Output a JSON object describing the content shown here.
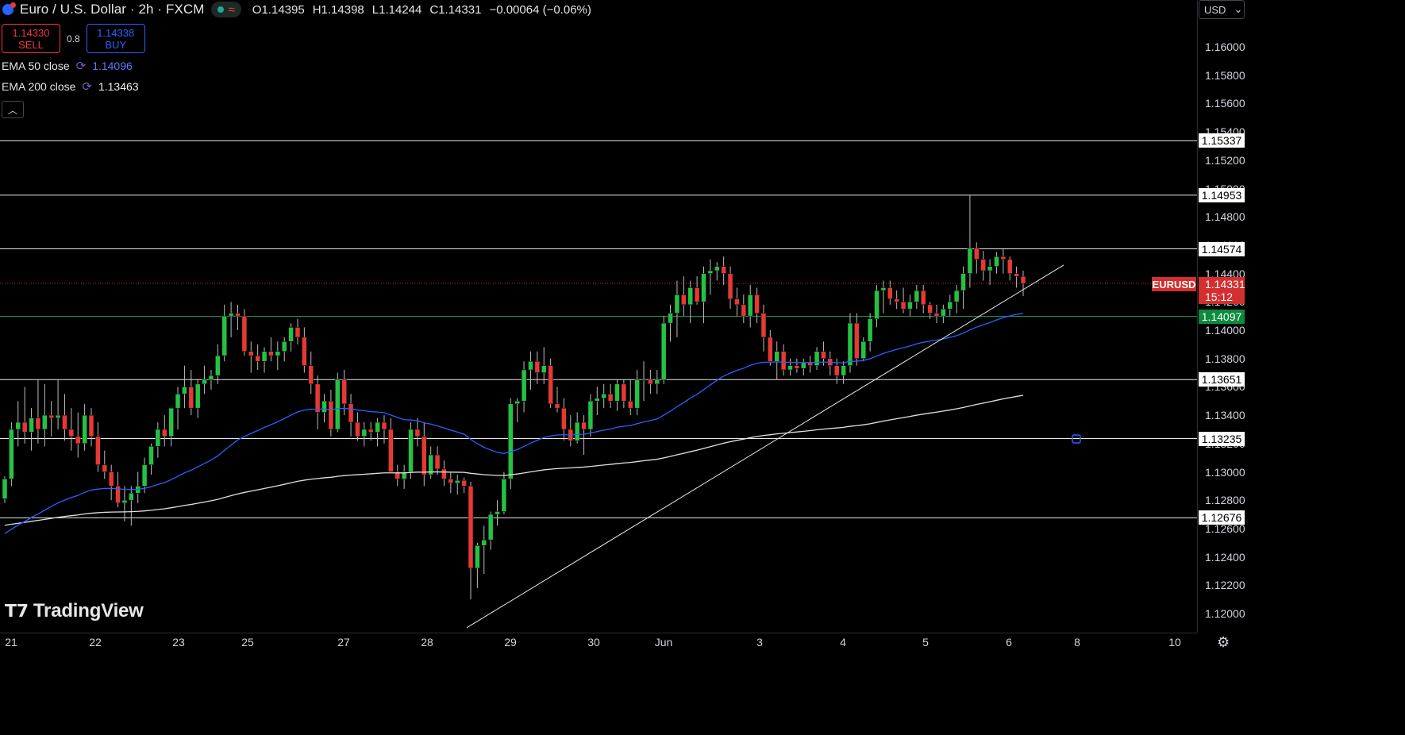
{
  "header": {
    "title": "Euro / U.S. Dollar · 2h · FXCM",
    "o_label": "O",
    "o": "1.14395",
    "h_label": "H",
    "h": "1.14398",
    "l_label": "L",
    "l": "1.14244",
    "c_label": "C",
    "c": "1.14331",
    "change": "−0.00064 (−0.06%)"
  },
  "trade": {
    "sell_price": "1.14330",
    "sell_label": "SELL",
    "spread": "0.8",
    "buy_price": "1.14338",
    "buy_label": "BUY"
  },
  "indicators": [
    {
      "label": "EMA 50 close",
      "value": "1.14096",
      "color": "#2962ff"
    },
    {
      "label": "EMA 200 close",
      "value": "1.13463",
      "color": "#e0e0e0"
    }
  ],
  "logo": "TradingView",
  "currency": "USD",
  "symbol": "EURUSD",
  "current_price": "1.14331",
  "countdown": "15:12",
  "chart_data": {
    "type": "candlestick",
    "ylim": [
      1.1188,
      1.164
    ],
    "y_ticks": [
      "1.16000",
      "1.15800",
      "1.15600",
      "1.15400",
      "1.15200",
      "1.15000",
      "1.14800",
      "1.14600",
      "1.14400",
      "1.14200",
      "1.14000",
      "1.13800",
      "1.13600",
      "1.13400",
      "1.13200",
      "1.13000",
      "1.12800",
      "1.12600",
      "1.12400",
      "1.12200",
      "1.12000"
    ],
    "x_ticks": [
      "21",
      "22",
      "23",
      "25",
      "27",
      "28",
      "29",
      "30",
      "Jun",
      "3",
      "4",
      "5",
      "6",
      "8",
      "10"
    ],
    "horizontal_levels": [
      {
        "value": 1.15337,
        "label": "1.15337"
      },
      {
        "value": 1.14953,
        "label": "1.14953"
      },
      {
        "value": 1.14574,
        "label": "1.14574"
      },
      {
        "value": 1.14097,
        "label": "1.14097",
        "color": "#1fa45a"
      },
      {
        "value": 1.13651,
        "label": "1.13651"
      },
      {
        "value": 1.13235,
        "label": "1.13235"
      },
      {
        "value": 1.12676,
        "label": "1.12676"
      }
    ],
    "trendline": [
      [
        1.119,
        1.1446
      ]
    ],
    "candles": [
      [
        1.1281,
        1.1297,
        1.1278,
        1.1295
      ],
      [
        1.1295,
        1.1335,
        1.129,
        1.133
      ],
      [
        1.133,
        1.135,
        1.1318,
        1.1335
      ],
      [
        1.1335,
        1.136,
        1.132,
        1.1328
      ],
      [
        1.1328,
        1.1345,
        1.1315,
        1.1338
      ],
      [
        1.1338,
        1.1365,
        1.132,
        1.133
      ],
      [
        1.133,
        1.1362,
        1.1318,
        1.134
      ],
      [
        1.134,
        1.135,
        1.1325,
        1.1338
      ],
      [
        1.1338,
        1.1365,
        1.133,
        1.134
      ],
      [
        1.134,
        1.1355,
        1.1322,
        1.133
      ],
      [
        1.133,
        1.1345,
        1.1315,
        1.1325
      ],
      [
        1.1325,
        1.1342,
        1.131,
        1.132
      ],
      [
        1.132,
        1.1348,
        1.1315,
        1.134
      ],
      [
        1.134,
        1.1345,
        1.1318,
        1.1325
      ],
      [
        1.1325,
        1.1335,
        1.13,
        1.1305
      ],
      [
        1.1305,
        1.1315,
        1.1295,
        1.13
      ],
      [
        1.13,
        1.1305,
        1.128,
        1.129
      ],
      [
        1.129,
        1.13,
        1.1275,
        1.1278
      ],
      [
        1.1278,
        1.129,
        1.1265,
        1.128
      ],
      [
        1.128,
        1.129,
        1.1262,
        1.1285
      ],
      [
        1.1285,
        1.13,
        1.1278,
        1.129
      ],
      [
        1.129,
        1.131,
        1.1285,
        1.1305
      ],
      [
        1.1305,
        1.132,
        1.1298,
        1.1318
      ],
      [
        1.1318,
        1.1335,
        1.131,
        1.133
      ],
      [
        1.133,
        1.134,
        1.1318,
        1.1325
      ],
      [
        1.1325,
        1.1345,
        1.1318,
        1.1345
      ],
      [
        1.1345,
        1.136,
        1.133,
        1.1355
      ],
      [
        1.1355,
        1.1375,
        1.1345,
        1.136
      ],
      [
        1.136,
        1.1372,
        1.134,
        1.1345
      ],
      [
        1.1345,
        1.1365,
        1.1338,
        1.1362
      ],
      [
        1.1362,
        1.1375,
        1.1355,
        1.1365
      ],
      [
        1.1365,
        1.1372,
        1.1358,
        1.1368
      ],
      [
        1.1368,
        1.139,
        1.1362,
        1.1382
      ],
      [
        1.1382,
        1.1418,
        1.1378,
        1.141
      ],
      [
        1.141,
        1.142,
        1.1395,
        1.1412
      ],
      [
        1.1412,
        1.1418,
        1.14,
        1.141
      ],
      [
        1.141,
        1.1415,
        1.1382,
        1.1385
      ],
      [
        1.1385,
        1.1392,
        1.137,
        1.1382
      ],
      [
        1.1382,
        1.139,
        1.1372,
        1.1378
      ],
      [
        1.1378,
        1.1388,
        1.137,
        1.1385
      ],
      [
        1.1385,
        1.1395,
        1.1378,
        1.1382
      ],
      [
        1.1382,
        1.1392,
        1.1372,
        1.1385
      ],
      [
        1.1385,
        1.1395,
        1.1378,
        1.1392
      ],
      [
        1.1392,
        1.1405,
        1.1385,
        1.1402
      ],
      [
        1.1402,
        1.1408,
        1.139,
        1.1395
      ],
      [
        1.1395,
        1.1402,
        1.137,
        1.1375
      ],
      [
        1.1375,
        1.1385,
        1.1355,
        1.1362
      ],
      [
        1.1362,
        1.1368,
        1.133,
        1.1342
      ],
      [
        1.1342,
        1.1355,
        1.1335,
        1.135
      ],
      [
        1.135,
        1.1358,
        1.1325,
        1.133
      ],
      [
        1.133,
        1.137,
        1.1328,
        1.1365
      ],
      [
        1.1365,
        1.1372,
        1.134,
        1.1348
      ],
      [
        1.1348,
        1.1355,
        1.1325,
        1.1335
      ],
      [
        1.1335,
        1.1342,
        1.1322,
        1.1325
      ],
      [
        1.1325,
        1.1335,
        1.1318,
        1.133
      ],
      [
        1.133,
        1.1335,
        1.1322,
        1.1328
      ],
      [
        1.1328,
        1.1338,
        1.1318,
        1.1335
      ],
      [
        1.1335,
        1.134,
        1.132,
        1.133
      ],
      [
        1.133,
        1.1338,
        1.131,
        1.13
      ],
      [
        1.13,
        1.1305,
        1.129,
        1.1295
      ],
      [
        1.1295,
        1.1305,
        1.1288,
        1.13
      ],
      [
        1.13,
        1.1335,
        1.1295,
        1.133
      ],
      [
        1.133,
        1.1338,
        1.1318,
        1.1325
      ],
      [
        1.1325,
        1.1335,
        1.129,
        1.1298
      ],
      [
        1.1298,
        1.1318,
        1.1295,
        1.1312
      ],
      [
        1.1312,
        1.1318,
        1.1298,
        1.1302
      ],
      [
        1.1302,
        1.1308,
        1.129,
        1.1295
      ],
      [
        1.1295,
        1.13,
        1.1285,
        1.1292
      ],
      [
        1.1292,
        1.1298,
        1.1284,
        1.1294
      ],
      [
        1.1294,
        1.1296,
        1.1285,
        1.129
      ],
      [
        1.129,
        1.1293,
        1.121,
        1.1232
      ],
      [
        1.1232,
        1.125,
        1.1218,
        1.1248
      ],
      [
        1.1248,
        1.1262,
        1.1228,
        1.1252
      ],
      [
        1.1252,
        1.1272,
        1.1245,
        1.127
      ],
      [
        1.127,
        1.128,
        1.1262,
        1.1272
      ],
      [
        1.1272,
        1.13,
        1.127,
        1.1295
      ],
      [
        1.1295,
        1.1352,
        1.1288,
        1.1348
      ],
      [
        1.1348,
        1.1352,
        1.1335,
        1.135
      ],
      [
        1.135,
        1.1378,
        1.1342,
        1.1372
      ],
      [
        1.1372,
        1.1385,
        1.1358,
        1.1378
      ],
      [
        1.1378,
        1.1385,
        1.1362,
        1.137
      ],
      [
        1.137,
        1.1388,
        1.1362,
        1.1375
      ],
      [
        1.1375,
        1.138,
        1.1345,
        1.1348
      ],
      [
        1.1348,
        1.136,
        1.1342,
        1.1345
      ],
      [
        1.1345,
        1.1352,
        1.1322,
        1.133
      ],
      [
        1.133,
        1.134,
        1.1318,
        1.1322
      ],
      [
        1.1322,
        1.1342,
        1.132,
        1.1335
      ],
      [
        1.1335,
        1.134,
        1.1312,
        1.133
      ],
      [
        1.133,
        1.1355,
        1.1325,
        1.135
      ],
      [
        1.135,
        1.136,
        1.134,
        1.1352
      ],
      [
        1.1352,
        1.1362,
        1.1345,
        1.1355
      ],
      [
        1.1355,
        1.1362,
        1.1345,
        1.135
      ],
      [
        1.135,
        1.1365,
        1.1343,
        1.1362
      ],
      [
        1.1362,
        1.1365,
        1.1345,
        1.135
      ],
      [
        1.135,
        1.1365,
        1.134,
        1.1345
      ],
      [
        1.1345,
        1.1372,
        1.134,
        1.1365
      ],
      [
        1.1365,
        1.1378,
        1.135,
        1.1365
      ],
      [
        1.1365,
        1.1372,
        1.1355,
        1.1362
      ],
      [
        1.1362,
        1.1372,
        1.1355,
        1.1365
      ],
      [
        1.1365,
        1.141,
        1.1362,
        1.1405
      ],
      [
        1.1405,
        1.1418,
        1.1392,
        1.1412
      ],
      [
        1.1412,
        1.1435,
        1.1395,
        1.1425
      ],
      [
        1.1425,
        1.1438,
        1.141,
        1.1418
      ],
      [
        1.1418,
        1.1435,
        1.1405,
        1.143
      ],
      [
        1.143,
        1.1438,
        1.1418,
        1.142
      ],
      [
        1.142,
        1.1445,
        1.1405,
        1.144
      ],
      [
        1.144,
        1.145,
        1.1425,
        1.1442
      ],
      [
        1.1442,
        1.1448,
        1.1435,
        1.1445
      ],
      [
        1.1445,
        1.1452,
        1.1432,
        1.144
      ],
      [
        1.144,
        1.1445,
        1.1415,
        1.1422
      ],
      [
        1.1422,
        1.143,
        1.141,
        1.1418
      ],
      [
        1.1418,
        1.1425,
        1.1405,
        1.141
      ],
      [
        1.141,
        1.1432,
        1.1402,
        1.1425
      ],
      [
        1.1425,
        1.143,
        1.1405,
        1.1412
      ],
      [
        1.1412,
        1.1418,
        1.1385,
        1.1395
      ],
      [
        1.1395,
        1.14,
        1.1375,
        1.1378
      ],
      [
        1.1378,
        1.1392,
        1.1365,
        1.1385
      ],
      [
        1.1385,
        1.139,
        1.1368,
        1.1372
      ],
      [
        1.1372,
        1.138,
        1.1368,
        1.1375
      ],
      [
        1.1375,
        1.138,
        1.137,
        1.1373
      ],
      [
        1.1373,
        1.138,
        1.1368,
        1.1377
      ],
      [
        1.1377,
        1.1382,
        1.137,
        1.1375
      ],
      [
        1.1375,
        1.1388,
        1.1372,
        1.1385
      ],
      [
        1.1385,
        1.1392,
        1.1375,
        1.138
      ],
      [
        1.138,
        1.1385,
        1.1368,
        1.1375
      ],
      [
        1.1375,
        1.138,
        1.1362,
        1.1368
      ],
      [
        1.1368,
        1.1378,
        1.1362,
        1.1375
      ],
      [
        1.1375,
        1.1412,
        1.137,
        1.1405
      ],
      [
        1.1405,
        1.1412,
        1.1375,
        1.138
      ],
      [
        1.138,
        1.1395,
        1.1378,
        1.1392
      ],
      [
        1.1392,
        1.1412,
        1.1385,
        1.1408
      ],
      [
        1.1408,
        1.1432,
        1.1402,
        1.1428
      ],
      [
        1.1428,
        1.1435,
        1.1412,
        1.143
      ],
      [
        1.143,
        1.1435,
        1.1418,
        1.1422
      ],
      [
        1.1422,
        1.1428,
        1.1415,
        1.142
      ],
      [
        1.142,
        1.143,
        1.1412,
        1.1415
      ],
      [
        1.1415,
        1.1425,
        1.141,
        1.142
      ],
      [
        1.142,
        1.1432,
        1.1415,
        1.1428
      ],
      [
        1.1428,
        1.1432,
        1.1412,
        1.1418
      ],
      [
        1.1418,
        1.142,
        1.1408,
        1.1412
      ],
      [
        1.1412,
        1.1418,
        1.1405,
        1.141
      ],
      [
        1.141,
        1.1418,
        1.1405,
        1.1415
      ],
      [
        1.1415,
        1.1425,
        1.141,
        1.142
      ],
      [
        1.142,
        1.1432,
        1.1412,
        1.1428
      ],
      [
        1.1428,
        1.1445,
        1.1415,
        1.144
      ],
      [
        1.144,
        1.1495,
        1.143,
        1.1458
      ],
      [
        1.1458,
        1.1462,
        1.144,
        1.145
      ],
      [
        1.145,
        1.1456,
        1.1435,
        1.1442
      ],
      [
        1.1442,
        1.145,
        1.1432,
        1.1445
      ],
      [
        1.1445,
        1.1455,
        1.144,
        1.1452
      ],
      [
        1.1452,
        1.1458,
        1.144,
        1.145
      ],
      [
        1.145,
        1.1452,
        1.1435,
        1.144
      ],
      [
        1.144,
        1.1445,
        1.143,
        1.1438
      ],
      [
        1.1438,
        1.1442,
        1.1424,
        1.1433
      ]
    ]
  }
}
